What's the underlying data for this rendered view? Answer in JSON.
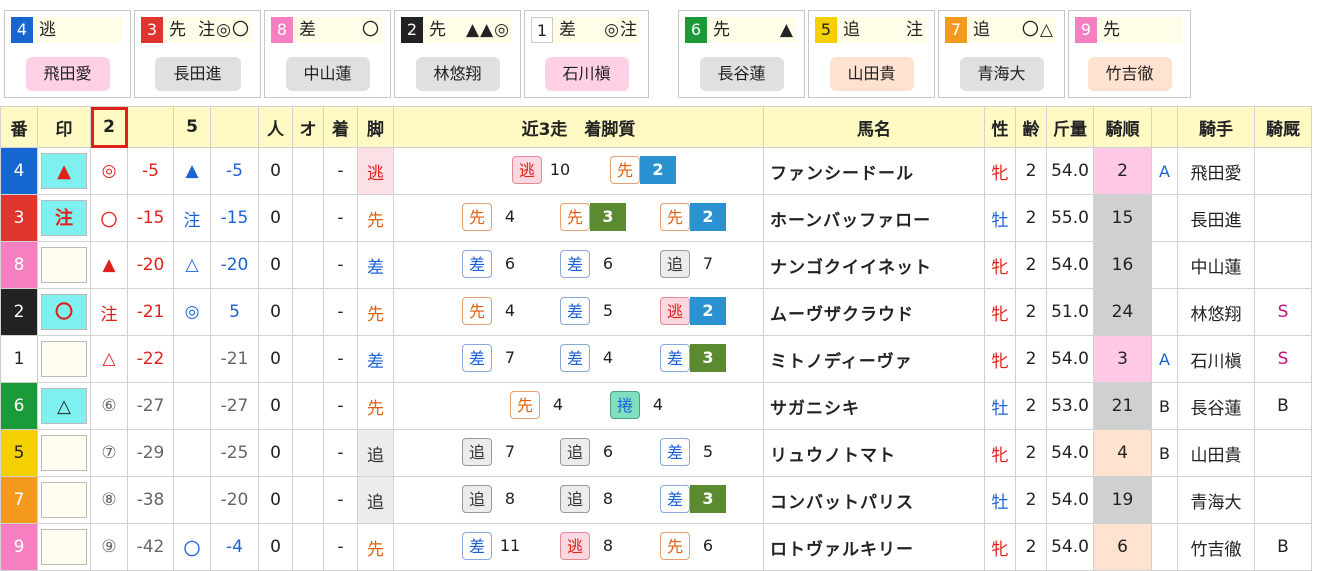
{
  "cards": [
    {
      "num": "4",
      "style": "逃",
      "marks": "",
      "jockey": "飛田愛",
      "color": "n4",
      "bg": "pink"
    },
    {
      "num": "3",
      "style": "先",
      "marks": "注◎〇",
      "jockey": "長田進",
      "color": "n3",
      "bg": "grey"
    },
    {
      "num": "8",
      "style": "差",
      "marks": "〇",
      "jockey": "中山蓮",
      "color": "n8",
      "bg": "grey"
    },
    {
      "num": "2",
      "style": "先",
      "marks": "▲▲◎",
      "jockey": "林悠翔",
      "color": "n2",
      "bg": "grey"
    },
    {
      "num": "1",
      "style": "差",
      "marks": "◎注",
      "jockey": "石川槇",
      "color": "n1",
      "bg": "pink"
    },
    {
      "num": "6",
      "style": "先",
      "marks": "▲",
      "jockey": "長谷蓮",
      "color": "n6",
      "bg": "grey"
    },
    {
      "num": "5",
      "style": "追",
      "marks": "注",
      "jockey": "山田貴",
      "color": "n5",
      "bg": "peach"
    },
    {
      "num": "7",
      "style": "追",
      "marks": "〇△",
      "jockey": "青海大",
      "color": "n7",
      "bg": "grey"
    },
    {
      "num": "9",
      "style": "先",
      "marks": "",
      "jockey": "竹吉徹",
      "color": "n9",
      "bg": "peach"
    }
  ],
  "headers": {
    "ban": "番",
    "shirushi": "印",
    "h2": "2",
    "h5": "5",
    "ninki": "人",
    "odds": "オ",
    "chaku": "着",
    "kyaku": "脚",
    "recent": "近3走　着脚質",
    "horse": "馬名",
    "sex": "性",
    "age": "齢",
    "weight": "斤量",
    "kijun": "騎順",
    "jockey": "騎手",
    "kikyu": "騎厩"
  },
  "rows": [
    {
      "num": "4",
      "color": "n4",
      "mark": "▲",
      "markcls": "red",
      "markbg": "cy",
      "m2": "◎",
      "m2cls": "red",
      "v2": "-5",
      "v2cls": "red",
      "m5": "▲",
      "m5cls": "blue",
      "v5": "-5",
      "v5cls": "blue",
      "ninki": "0",
      "odds": "",
      "chaku": "-",
      "kyaku": "逃",
      "kyakucls": "st-nige",
      "runs": [
        {
          "tag": "逃",
          "tc": "nige",
          "pos": "10",
          "pc": ""
        },
        {
          "tag": "先",
          "tc": "saki",
          "pos": "2",
          "pc": "win-blue"
        }
      ],
      "horse": "ファンシードール",
      "sex": "牝",
      "sexcls": "sex-f",
      "age": "2",
      "weight": "54.0",
      "kijun": "2",
      "kijuncls": "rank-pink",
      "ab": "A",
      "abcls": "ab-blue",
      "jockey": "飛田愛",
      "kikyu": "",
      "kikyucls": ""
    },
    {
      "num": "3",
      "color": "n3",
      "mark": "注",
      "markcls": "red",
      "markbg": "cy",
      "m2": "〇",
      "m2cls": "red",
      "v2": "-15",
      "v2cls": "red",
      "m5": "注",
      "m5cls": "blue",
      "v5": "-15",
      "v5cls": "blue",
      "ninki": "0",
      "odds": "",
      "chaku": "-",
      "kyaku": "先",
      "kyakucls": "c-saki",
      "runs": [
        {
          "tag": "先",
          "tc": "saki",
          "pos": "4",
          "pc": ""
        },
        {
          "tag": "先",
          "tc": "saki",
          "pos": "3",
          "pc": "win-green"
        },
        {
          "tag": "先",
          "tc": "saki",
          "pos": "2",
          "pc": "win-blue"
        }
      ],
      "horse": "ホーンバッファロー",
      "sex": "牡",
      "sexcls": "sex-m",
      "age": "2",
      "weight": "55.0",
      "kijun": "15",
      "kijuncls": "rank-grey",
      "ab": "",
      "abcls": "",
      "jockey": "長田進",
      "kikyu": "",
      "kikyucls": ""
    },
    {
      "num": "8",
      "color": "n8",
      "mark": "",
      "markcls": "",
      "markbg": "",
      "m2": "▲",
      "m2cls": "red",
      "v2": "-20",
      "v2cls": "red",
      "m5": "△",
      "m5cls": "blue",
      "v5": "-20",
      "v5cls": "blue",
      "ninki": "0",
      "odds": "",
      "chaku": "-",
      "kyaku": "差",
      "kyakucls": "c-sashi",
      "runs": [
        {
          "tag": "差",
          "tc": "sashi",
          "pos": "6",
          "pc": ""
        },
        {
          "tag": "差",
          "tc": "sashi",
          "pos": "6",
          "pc": ""
        },
        {
          "tag": "追",
          "tc": "oi",
          "pos": "7",
          "pc": ""
        }
      ],
      "horse": "ナンゴクイイネット",
      "sex": "牝",
      "sexcls": "sex-f",
      "age": "2",
      "weight": "54.0",
      "kijun": "16",
      "kijuncls": "rank-grey",
      "ab": "",
      "abcls": "",
      "jockey": "中山蓮",
      "kikyu": "",
      "kikyucls": ""
    },
    {
      "num": "2",
      "color": "n2",
      "mark": "〇",
      "markcls": "red",
      "markbg": "cy",
      "m2": "注",
      "m2cls": "red",
      "v2": "-21",
      "v2cls": "red",
      "m5": "◎",
      "m5cls": "blue",
      "v5": "5",
      "v5cls": "blue",
      "ninki": "0",
      "odds": "",
      "chaku": "-",
      "kyaku": "先",
      "kyakucls": "c-saki",
      "runs": [
        {
          "tag": "先",
          "tc": "saki",
          "pos": "4",
          "pc": ""
        },
        {
          "tag": "差",
          "tc": "sashi",
          "pos": "5",
          "pc": ""
        },
        {
          "tag": "逃",
          "tc": "nige",
          "pos": "2",
          "pc": "win-blue"
        }
      ],
      "horse": "ムーヴザクラウド",
      "sex": "牝",
      "sexcls": "sex-f",
      "age": "2",
      "weight": "51.0",
      "kijun": "24",
      "kijuncls": "rank-grey",
      "ab": "",
      "abcls": "",
      "jockey": "林悠翔",
      "kikyu": "S",
      "kikyucls": "tail-s"
    },
    {
      "num": "1",
      "color": "n1",
      "mark": "",
      "markcls": "",
      "markbg": "",
      "m2": "△",
      "m2cls": "red",
      "v2": "-22",
      "v2cls": "red",
      "m5": "",
      "m5cls": "",
      "v5": "-21",
      "v5cls": "gray",
      "ninki": "0",
      "odds": "",
      "chaku": "-",
      "kyaku": "差",
      "kyakucls": "c-sashi",
      "runs": [
        {
          "tag": "差",
          "tc": "sashi",
          "pos": "7",
          "pc": ""
        },
        {
          "tag": "差",
          "tc": "sashi",
          "pos": "4",
          "pc": ""
        },
        {
          "tag": "差",
          "tc": "sashi",
          "pos": "3",
          "pc": "win-green"
        }
      ],
      "horse": "ミトノディーヴァ",
      "sex": "牝",
      "sexcls": "sex-f",
      "age": "2",
      "weight": "54.0",
      "kijun": "3",
      "kijuncls": "rank-pink",
      "ab": "A",
      "abcls": "ab-blue",
      "jockey": "石川槇",
      "kikyu": "S",
      "kikyucls": "tail-s"
    },
    {
      "num": "6",
      "color": "n6",
      "mark": "△",
      "markcls": "",
      "markbg": "cy",
      "m2": "⑥",
      "m2cls": "gray",
      "v2": "-27",
      "v2cls": "gray",
      "m5": "",
      "m5cls": "",
      "v5": "-27",
      "v5cls": "gray",
      "ninki": "0",
      "odds": "",
      "chaku": "-",
      "kyaku": "先",
      "kyakucls": "c-saki",
      "runs": [
        {
          "tag": "先",
          "tc": "saki",
          "pos": "4",
          "pc": ""
        },
        {
          "tag": "捲",
          "tc": "maki",
          "pos": "4",
          "pc": ""
        }
      ],
      "horse": "サガニシキ",
      "sex": "牡",
      "sexcls": "sex-m",
      "age": "2",
      "weight": "53.0",
      "kijun": "21",
      "kijuncls": "rank-grey",
      "ab": "B",
      "abcls": "",
      "jockey": "長谷蓮",
      "kikyu": "B",
      "kikyucls": ""
    },
    {
      "num": "5",
      "color": "n5",
      "mark": "",
      "markcls": "",
      "markbg": "",
      "m2": "⑦",
      "m2cls": "gray",
      "v2": "-29",
      "v2cls": "gray",
      "m5": "",
      "m5cls": "",
      "v5": "-25",
      "v5cls": "gray",
      "ninki": "0",
      "odds": "",
      "chaku": "-",
      "kyaku": "追",
      "kyakucls": "st-oi",
      "runs": [
        {
          "tag": "追",
          "tc": "oi",
          "pos": "7",
          "pc": ""
        },
        {
          "tag": "追",
          "tc": "oi",
          "pos": "6",
          "pc": ""
        },
        {
          "tag": "差",
          "tc": "sashi",
          "pos": "5",
          "pc": ""
        }
      ],
      "horse": "リュウノトマト",
      "sex": "牝",
      "sexcls": "sex-f",
      "age": "2",
      "weight": "54.0",
      "kijun": "4",
      "kijuncls": "rank-peach",
      "ab": "B",
      "abcls": "",
      "jockey": "山田貴",
      "kikyu": "",
      "kikyucls": ""
    },
    {
      "num": "7",
      "color": "n7",
      "mark": "",
      "markcls": "",
      "markbg": "",
      "m2": "⑧",
      "m2cls": "gray",
      "v2": "-38",
      "v2cls": "gray",
      "m5": "",
      "m5cls": "",
      "v5": "-20",
      "v5cls": "gray",
      "ninki": "0",
      "odds": "",
      "chaku": "-",
      "kyaku": "追",
      "kyakucls": "st-oi",
      "runs": [
        {
          "tag": "追",
          "tc": "oi",
          "pos": "8",
          "pc": ""
        },
        {
          "tag": "追",
          "tc": "oi",
          "pos": "8",
          "pc": ""
        },
        {
          "tag": "差",
          "tc": "sashi",
          "pos": "3",
          "pc": "win-green"
        }
      ],
      "horse": "コンバットパリス",
      "sex": "牡",
      "sexcls": "sex-m",
      "age": "2",
      "weight": "54.0",
      "kijun": "19",
      "kijuncls": "rank-grey",
      "ab": "",
      "abcls": "",
      "jockey": "青海大",
      "kikyu": "",
      "kikyucls": ""
    },
    {
      "num": "9",
      "color": "n9",
      "mark": "",
      "markcls": "",
      "markbg": "",
      "m2": "⑨",
      "m2cls": "gray",
      "v2": "-42",
      "v2cls": "gray",
      "m5": "〇",
      "m5cls": "blue",
      "v5": "-4",
      "v5cls": "blue",
      "ninki": "0",
      "odds": "",
      "chaku": "-",
      "kyaku": "先",
      "kyakucls": "c-saki",
      "runs": [
        {
          "tag": "差",
          "tc": "sashi",
          "pos": "11",
          "pc": ""
        },
        {
          "tag": "逃",
          "tc": "nige",
          "pos": "8",
          "pc": ""
        },
        {
          "tag": "先",
          "tc": "saki",
          "pos": "6",
          "pc": ""
        }
      ],
      "horse": "ロトヴァルキリー",
      "sex": "牝",
      "sexcls": "sex-f",
      "age": "2",
      "weight": "54.0",
      "kijun": "6",
      "kijuncls": "rank-peach",
      "ab": "",
      "abcls": "",
      "jockey": "竹吉徹",
      "kikyu": "B",
      "kikyucls": ""
    }
  ]
}
